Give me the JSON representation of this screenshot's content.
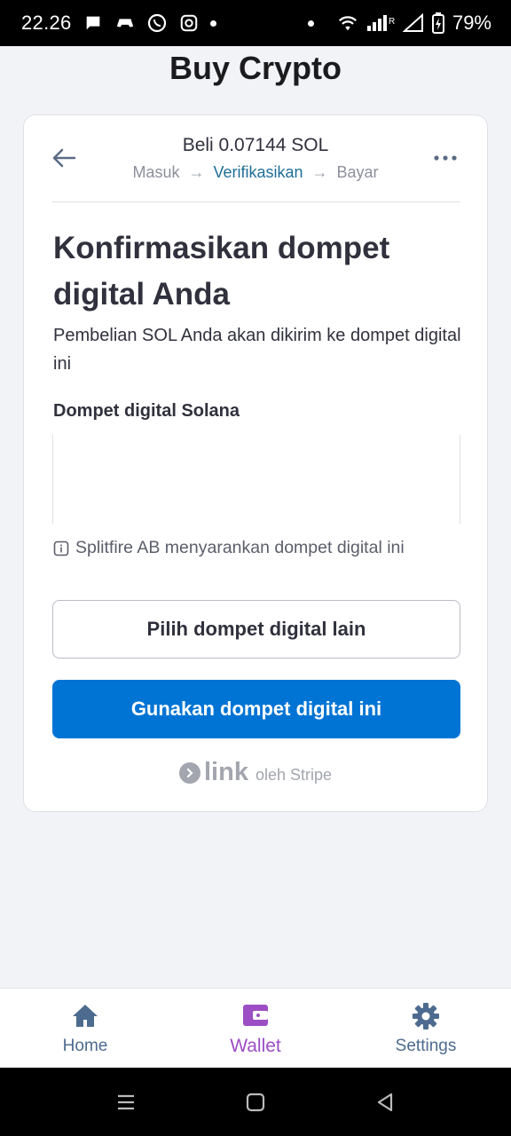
{
  "status_bar": {
    "time": "22.26",
    "battery": "79%"
  },
  "page": {
    "title": "Buy Crypto"
  },
  "card": {
    "header_title": "Beli 0.07144 SOL",
    "breadcrumb": {
      "step1": "Masuk",
      "step2": "Verifikasikan",
      "step3": "Bayar"
    },
    "heading": "Konfirmasikan dompet digital Anda",
    "subtext": "Pembelian SOL Anda akan dikirim ke dompet digital ini",
    "wallet_label": "Dompet digital Solana",
    "wallet_name": "",
    "wallet_address": "",
    "suggestion": "Splitfire AB menyarankan dompet digital ini",
    "secondary_button": "Pilih dompet digital lain",
    "primary_button": "Gunakan dompet digital ini",
    "powered_by": {
      "brand": "link",
      "text": "oleh Stripe"
    }
  },
  "bottom_nav": {
    "items": [
      {
        "label": "Home",
        "icon": "home-icon"
      },
      {
        "label": "Wallet",
        "icon": "wallet-icon",
        "active": true
      },
      {
        "label": "Settings",
        "icon": "gear-icon"
      }
    ]
  },
  "colors": {
    "primary": "#0074d4",
    "active_nav": "#9c4ec4",
    "inactive_nav": "#4d6b8f",
    "breadcrumb_active": "#1f6e98"
  }
}
